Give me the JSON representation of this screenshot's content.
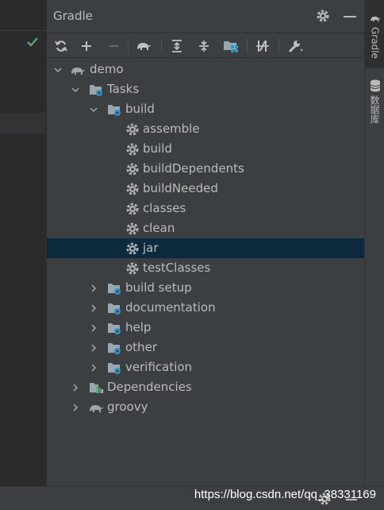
{
  "panel": {
    "title": "Gradle"
  },
  "toolbar": {
    "buttons": [
      "refresh-icon",
      "add-icon",
      "remove-icon",
      "gradle-elephant-icon",
      "expand-all-icon",
      "collapse-all-icon",
      "group-modules-icon",
      "toggle-offline-icon",
      "settings-wrench-icon"
    ]
  },
  "tree": {
    "demo": "demo",
    "tasks": "Tasks",
    "build_group": "build",
    "build_tasks": [
      "assemble",
      "build",
      "buildDependents",
      "buildNeeded",
      "classes",
      "clean",
      "jar",
      "testClasses"
    ],
    "selected_task": "jar",
    "other_groups": [
      "build setup",
      "documentation",
      "help",
      "other",
      "verification"
    ],
    "dependencies": "Dependencies",
    "groovy": "groovy"
  },
  "right_strip": {
    "gradle_tab": "Gradle",
    "database_tab": "数据库"
  },
  "footer": {
    "watermark": "https://blog.csdn.net/qq_38331169"
  },
  "colors": {
    "panel_bg": "#3c3f41",
    "selected_row": "#0d293e",
    "text": "#bbbbbb",
    "accent_blue": "#3592c4",
    "check_green": "#59a869"
  }
}
